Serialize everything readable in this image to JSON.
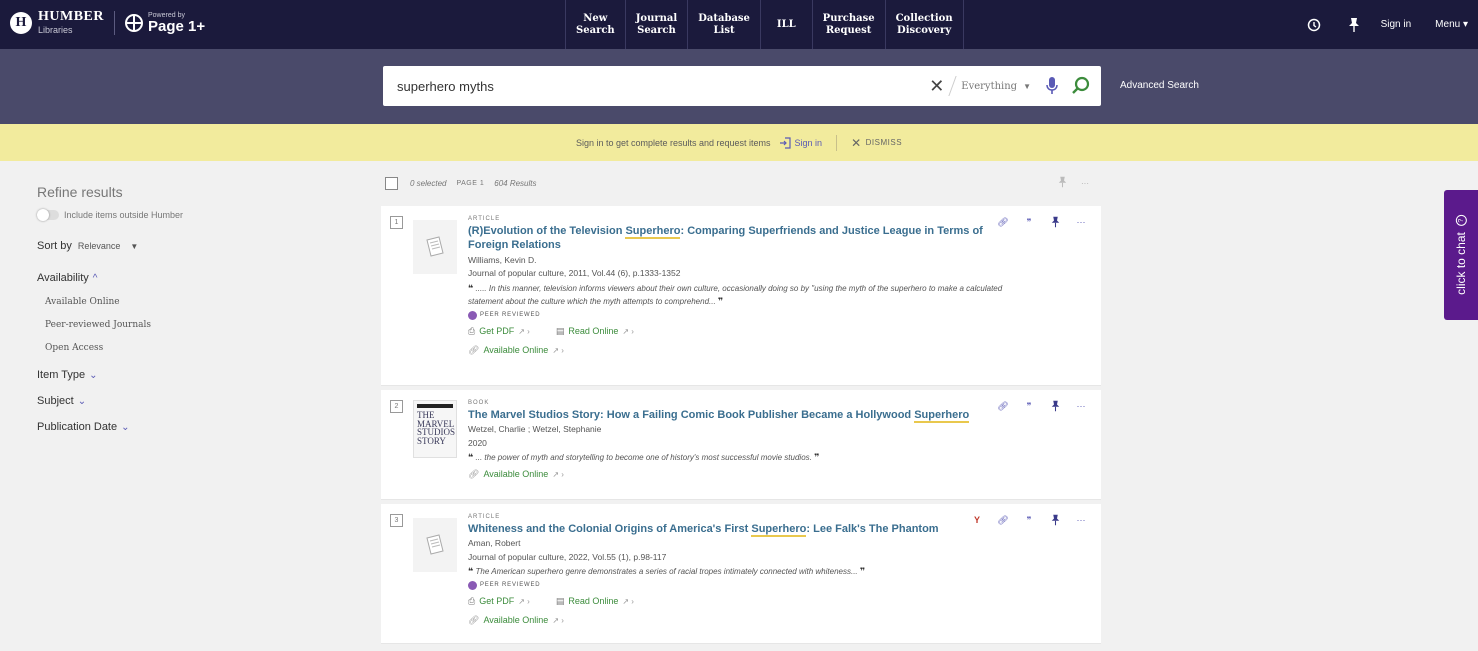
{
  "brand": {
    "name": "HUMBER",
    "sub": "Libraries",
    "powered": "Powered by",
    "product": "Page 1+"
  },
  "nav": [
    {
      "label": "New\nSearch"
    },
    {
      "label": "Journal\nSearch"
    },
    {
      "label": "Database\nList"
    },
    {
      "label": "ILL"
    },
    {
      "label": "Purchase\nRequest"
    },
    {
      "label": "Collection\nDiscovery"
    }
  ],
  "top_right": {
    "sign_in": "Sign in",
    "menu": "Menu"
  },
  "search": {
    "query": "superhero myths",
    "scope": "Everything",
    "advanced": "Advanced Search"
  },
  "banner": {
    "message": "Sign in to get complete results and request items",
    "sign_in": "Sign in",
    "dismiss": "DISMISS"
  },
  "facets": {
    "refine_title": "Refine results",
    "include_outside": "Include items outside Humber",
    "sort_label": "Sort by",
    "sort_value": "Relevance",
    "availability": "Availability",
    "availability_options": [
      "Available Online",
      "Peer-reviewed Journals",
      "Open Access"
    ],
    "item_type": "Item Type",
    "subject": "Subject",
    "publication_date": "Publication Date"
  },
  "results_header": {
    "selected": "0 selected",
    "page": "PAGE 1",
    "count": "604 Results"
  },
  "results": [
    {
      "index": "1",
      "type": "ARTICLE",
      "title_pre": "(R)Evolution of the Television ",
      "title_hl": "Superhero",
      "title_post": ": Comparing Superfriends and Justice League in Terms of Foreign Relations",
      "author": "Williams, Kevin D.",
      "source": "Journal of popular culture, 2011, Vol.44 (6), p.1333-1352",
      "snippet": "..... In this manner, television informs viewers about their own culture, occasionally doing so by \"using the myth of the superhero to make a calculated statement about the culture which the myth attempts to comprehend...",
      "peer": "PEER REVIEWED",
      "get_pdf": "Get PDF",
      "read_online": "Read Online",
      "available": "Available Online"
    },
    {
      "index": "2",
      "type": "BOOK",
      "title_pre": "The Marvel Studios Story: How a Failing Comic Book Publisher Became a Hollywood ",
      "title_hl": "Superhero",
      "title_post": "",
      "author": "Wetzel, Charlie ; Wetzel, Stephanie",
      "source": "2020",
      "snippet": "... the power of myth and storytelling to become one of history's most successful movie studios.",
      "cover_text": "THE MARVEL STUDIOS STORY",
      "available": "Available Online"
    },
    {
      "index": "3",
      "type": "ARTICLE",
      "title_pre": "Whiteness and the Colonial Origins of America's First ",
      "title_hl": "Superhero",
      "title_post": ": Lee Falk's The Phantom",
      "author": "Aman, Robert",
      "source": "Journal of popular culture, 2022, Vol.55 (1), p.98-117",
      "snippet": "The American superhero genre demonstrates a series of racial tropes intimately connected with whiteness...",
      "peer": "PEER REVIEWED",
      "get_pdf": "Get PDF",
      "read_online": "Read Online",
      "available": "Available Online"
    }
  ],
  "chat": {
    "label": "click to chat"
  },
  "colors": {
    "topbar": "#1b1a3c",
    "searchband": "#4a4a6a",
    "banner": "#f2eb9d",
    "link": "#3a6e8f",
    "available": "#3c8c3c",
    "chat": "#5b1a8c"
  }
}
